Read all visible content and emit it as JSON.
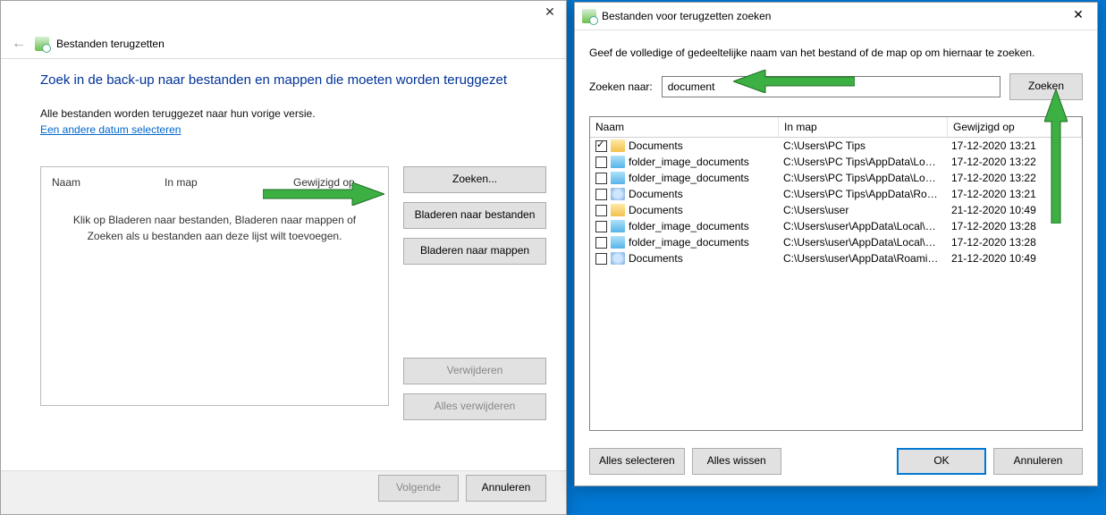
{
  "w1": {
    "title": "Bestanden terugzetten",
    "heading": "Zoek in de back-up naar bestanden en mappen die moeten worden teruggezet",
    "subtext": "Alle bestanden worden teruggezet naar hun vorige versie.",
    "link": "Een andere datum selecteren",
    "cols": {
      "name": "Naam",
      "folder": "In map",
      "date": "Gewijzigd op"
    },
    "placeholder": "Klik op Bladeren naar bestanden, Bladeren naar mappen of Zoeken als u bestanden aan deze lijst wilt toevoegen.",
    "btn_search": "Zoeken...",
    "btn_browse_files": "Bladeren naar bestanden",
    "btn_browse_folders": "Bladeren naar mappen",
    "btn_remove": "Verwijderen",
    "btn_remove_all": "Alles verwijderen",
    "btn_next": "Volgende",
    "btn_cancel": "Annuleren"
  },
  "w2": {
    "title": "Bestanden voor terugzetten zoeken",
    "instr": "Geef de volledige of gedeeltelijke naam van het bestand of de map op om hiernaar te zoeken.",
    "search_label": "Zoeken naar:",
    "search_value": "document",
    "btn_search": "Zoeken",
    "cols": {
      "name": "Naam",
      "folder": "In map",
      "date": "Gewijzigd op"
    },
    "rows": [
      {
        "checked": true,
        "icon": "folder-yellow",
        "name": "Documents",
        "folder": "C:\\Users\\PC Tips",
        "date": "17-12-2020 13:21"
      },
      {
        "checked": false,
        "icon": "img-bluegreen",
        "name": "folder_image_documents",
        "folder": "C:\\Users\\PC Tips\\AppData\\Local...",
        "date": "17-12-2020 13:22"
      },
      {
        "checked": false,
        "icon": "img-bluegreen",
        "name": "folder_image_documents",
        "folder": "C:\\Users\\PC Tips\\AppData\\Local...",
        "date": "17-12-2020 13:22"
      },
      {
        "checked": false,
        "icon": "doc-blue",
        "name": "Documents",
        "folder": "C:\\Users\\PC Tips\\AppData\\Roam...",
        "date": "17-12-2020 13:21"
      },
      {
        "checked": false,
        "icon": "folder-yellow",
        "name": "Documents",
        "folder": "C:\\Users\\user",
        "date": "21-12-2020 10:49"
      },
      {
        "checked": false,
        "icon": "img-bluegreen",
        "name": "folder_image_documents",
        "folder": "C:\\Users\\user\\AppData\\Local\\Mi...",
        "date": "17-12-2020 13:28"
      },
      {
        "checked": false,
        "icon": "img-bluegreen",
        "name": "folder_image_documents",
        "folder": "C:\\Users\\user\\AppData\\Local\\Mi...",
        "date": "17-12-2020 13:28"
      },
      {
        "checked": false,
        "icon": "doc-blue",
        "name": "Documents",
        "folder": "C:\\Users\\user\\AppData\\Roamin...",
        "date": "21-12-2020 10:49"
      }
    ],
    "btn_select_all": "Alles selecteren",
    "btn_clear": "Alles wissen",
    "btn_ok": "OK",
    "btn_cancel": "Annuleren"
  }
}
